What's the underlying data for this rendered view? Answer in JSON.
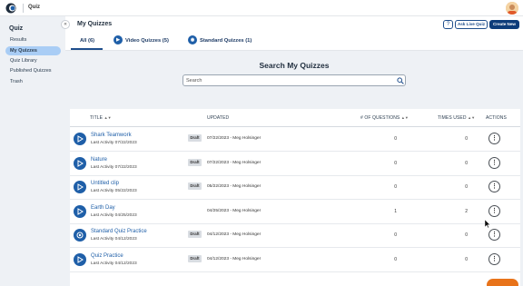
{
  "app": {
    "title": "Quiz"
  },
  "sidebar": {
    "heading": "Quiz",
    "items": [
      {
        "label": "Results"
      },
      {
        "label": "My Quizzes"
      },
      {
        "label": "Quiz Library"
      },
      {
        "label": "Published Quizzes"
      },
      {
        "label": "Trash"
      }
    ]
  },
  "header": {
    "title": "My Quizzes",
    "help_label": "?",
    "live_label": "Ask Live Quiz",
    "create_label": "Create New"
  },
  "tabs": [
    {
      "label": "All (6)"
    },
    {
      "label": "Video Quizzes (5)"
    },
    {
      "label": "Standard Quizzes (1)"
    }
  ],
  "search": {
    "heading": "Search My Quizzes",
    "placeholder": "Search"
  },
  "table": {
    "columns": [
      "TITLE",
      "UPDATED",
      "# OF QUESTIONS",
      "TIMES USED",
      "ACTIONS"
    ],
    "rows": [
      {
        "title": "Shark Teamwork",
        "activity": "Last Activity 07/22/2023",
        "badge": "Draft",
        "updated": "07/22/2023 - Meg Holsinger",
        "questions": "0",
        "used": "0",
        "type": "video"
      },
      {
        "title": "Nature",
        "activity": "Last Activity 07/22/2023",
        "badge": "Draft",
        "updated": "07/22/2023 - Meg Holsinger",
        "questions": "0",
        "used": "0",
        "type": "video"
      },
      {
        "title": "Untitled clip",
        "activity": "Last Activity 05/22/2023",
        "badge": "Draft",
        "updated": "05/22/2023 - Meg Holsinger",
        "questions": "0",
        "used": "0",
        "type": "video"
      },
      {
        "title": "Earth Day",
        "activity": "Last Activity 04/25/2023",
        "badge": "",
        "updated": "04/25/2023 - Meg Holsinger",
        "questions": "1",
        "used": "2",
        "type": "video"
      },
      {
        "title": "Standard Quiz Practice",
        "activity": "Last Activity 04/12/2023",
        "badge": "Draft",
        "updated": "04/12/2023 - Meg Holsinger",
        "questions": "0",
        "used": "0",
        "type": "standard"
      },
      {
        "title": "Quiz Practice",
        "activity": "Last Activity 04/12/2023",
        "badge": "Draft",
        "updated": "04/12/2023 - Meg Holsinger",
        "questions": "0",
        "used": "0",
        "type": "video"
      }
    ],
    "action_glyph": "⋮"
  },
  "colors": {
    "accent": "#1f5fa8",
    "primary_button": "#0d3c7a",
    "sidebar_active": "#a9cdf5",
    "fab": "#e8731a"
  }
}
